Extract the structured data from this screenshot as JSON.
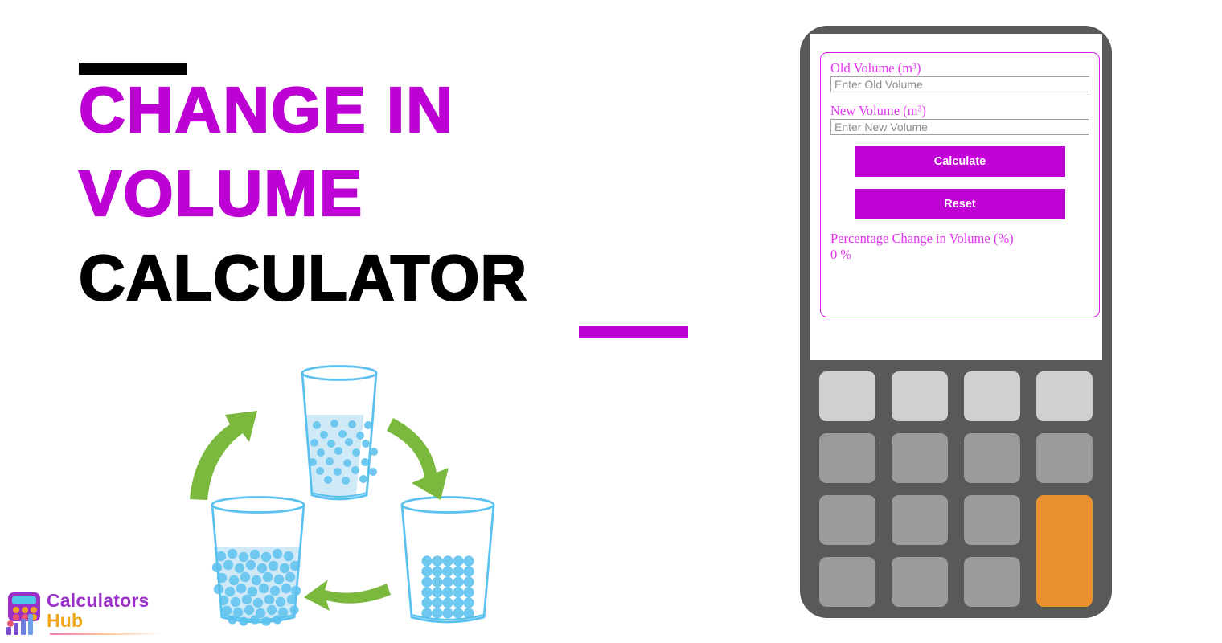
{
  "hero": {
    "title_line1": "CHANGE IN",
    "title_line2": "VOLUME",
    "title_line3": "CALCULATOR",
    "accent_color": "#bd00d4",
    "text_color": "#000000"
  },
  "illustration": {
    "name": "three-beakers-state-change-cycle",
    "beakers": [
      {
        "id": "beaker-gas-top",
        "state": "gas",
        "fill_level": "half",
        "particle_count": 26
      },
      {
        "id": "beaker-solid-right",
        "state": "solid",
        "fill_level": "none",
        "particle_count": 30
      },
      {
        "id": "beaker-liquid-left",
        "state": "liquid",
        "fill_level": "half",
        "particle_count": 58
      }
    ],
    "arrows": [
      {
        "id": "arrow-top-right",
        "direction": "clockwise"
      },
      {
        "id": "arrow-bottom",
        "direction": "clockwise"
      },
      {
        "id": "arrow-left",
        "direction": "clockwise"
      }
    ],
    "colors": {
      "outline": "#5bc2f0",
      "liquid": "#cfe9f7",
      "particle": "#6ec8f0",
      "arrow": "#7ab83e"
    }
  },
  "logo": {
    "name_part1": "Calculators",
    "name_part2": "Hub",
    "part1_color": "#9b30c9",
    "part2_color": "#f0a71e"
  },
  "calculator": {
    "body_color": "#58595b",
    "accent_color": "#c100d6",
    "fields": [
      {
        "id": "old-volume",
        "label": "Old Volume (m³)",
        "placeholder": "Enter Old Volume",
        "value": ""
      },
      {
        "id": "new-volume",
        "label": "New Volume (m³)",
        "placeholder": "Enter New Volume",
        "value": ""
      }
    ],
    "buttons": {
      "calculate_label": "Calculate",
      "reset_label": "Reset"
    },
    "result": {
      "label": "Percentage Change in Volume (%)",
      "value": "0 %"
    },
    "keypad": {
      "rows": 4,
      "cols": 4,
      "keys_blank": true,
      "light_row_index": 0,
      "orange_key": {
        "column": 4,
        "spans_rows": [
          3,
          4
        ],
        "color": "#e8912c"
      },
      "key_color": "#9a9b9d",
      "light_key_color": "#cfd0d1"
    }
  }
}
